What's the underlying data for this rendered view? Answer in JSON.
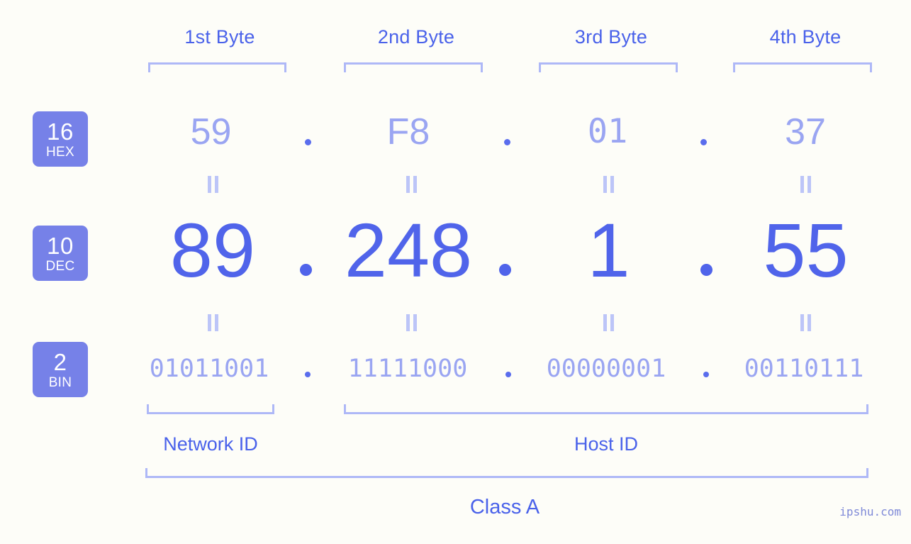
{
  "page": {
    "background": "#fdfdf8",
    "accent_strong": "#5064ea",
    "accent_mid": "#7681e8",
    "accent_light": "#9aa5f2",
    "bracket_color": "#aeb8f7",
    "watermark": "ipshu.com"
  },
  "byte_headers": [
    {
      "label": "1st Byte"
    },
    {
      "label": "2nd Byte"
    },
    {
      "label": "3rd Byte"
    },
    {
      "label": "4th Byte"
    }
  ],
  "rows": {
    "hex": {
      "badge_number": "16",
      "badge_name": "HEX",
      "values": [
        "59",
        "F8",
        "01",
        "37"
      ],
      "separator": "."
    },
    "dec": {
      "badge_number": "10",
      "badge_name": "DEC",
      "values": [
        "89",
        "248",
        "1",
        "55"
      ],
      "separator": "."
    },
    "bin": {
      "badge_number": "2",
      "badge_name": "BIN",
      "values": [
        "01011001",
        "11111000",
        "00000001",
        "00110111"
      ],
      "separator": "."
    }
  },
  "equals_marker": "=",
  "id_sections": [
    {
      "label": "Network ID"
    },
    {
      "label": "Host ID"
    }
  ],
  "class": {
    "label": "Class A"
  }
}
